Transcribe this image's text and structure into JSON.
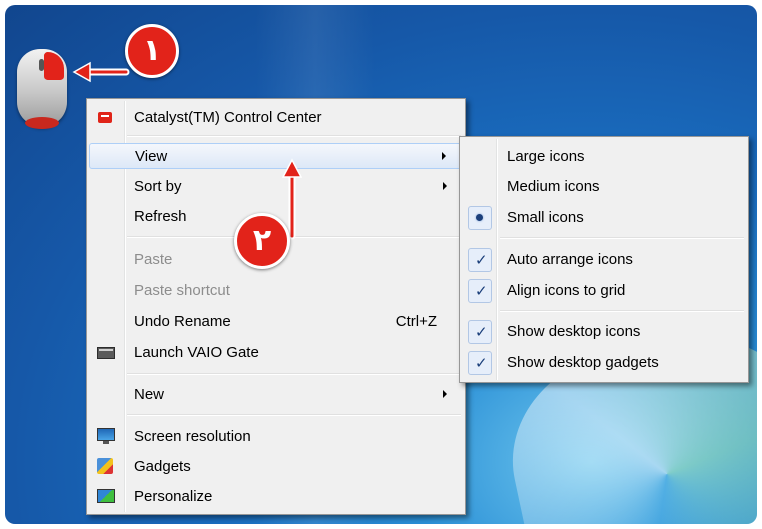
{
  "callouts": {
    "one": "١",
    "two": "٢"
  },
  "icons": {
    "mouse": "mouse-illustration",
    "ati": "ati-logo-icon",
    "vaio": "vaio-gate-icon",
    "screen": "screen-resolution-icon",
    "gadgets": "gadgets-icon",
    "personalize": "personalize-icon"
  },
  "colors": {
    "callout": "#e2231a",
    "menu_bg": "#f0f0f0",
    "highlight_border": "#aecff7"
  },
  "context_menu": {
    "items": [
      {
        "label": "Catalyst(TM) Control Center"
      },
      {
        "label": "View"
      },
      {
        "label": "Sort by"
      },
      {
        "label": "Refresh"
      },
      {
        "label": "Paste"
      },
      {
        "label": "Paste shortcut"
      },
      {
        "label": "Undo Rename",
        "shortcut": "Ctrl+Z"
      },
      {
        "label": "Launch VAIO Gate"
      },
      {
        "label": "New"
      },
      {
        "label": "Screen resolution"
      },
      {
        "label": "Gadgets"
      },
      {
        "label": "Personalize"
      }
    ]
  },
  "view_submenu": {
    "items": [
      {
        "label": "Large icons"
      },
      {
        "label": "Medium icons"
      },
      {
        "label": "Small icons",
        "selected": true
      },
      {
        "label": "Auto arrange icons",
        "checked": true
      },
      {
        "label": "Align icons to grid",
        "checked": true
      },
      {
        "label": "Show desktop icons",
        "checked": true
      },
      {
        "label": "Show desktop gadgets",
        "checked": true
      }
    ]
  }
}
